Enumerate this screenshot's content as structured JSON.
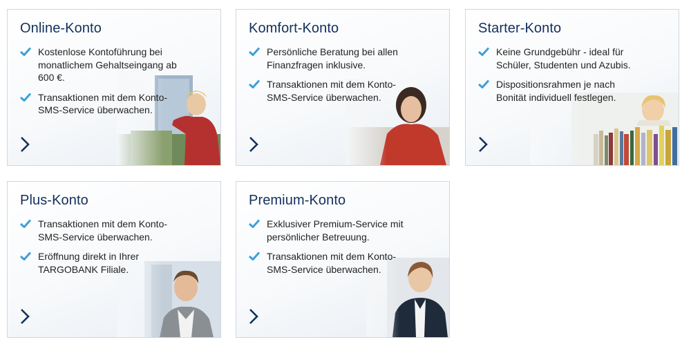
{
  "colors": {
    "title": "#12305c",
    "check": "#3b9fd8",
    "arrow": "#12305c",
    "border": "#d2d7dd"
  },
  "cards": [
    {
      "title": "Online-Konto",
      "features": [
        "Kostenlose Kontoführung bei monatlichem Gehaltseingang ab 600 €.",
        "Transaktionen mit dem Konto-SMS-Service überwachen."
      ]
    },
    {
      "title": "Komfort-Konto",
      "features": [
        "Persönliche Beratung bei allen Finanzfragen inklusive.",
        "Transaktionen mit dem Konto-SMS-Service überwachen."
      ]
    },
    {
      "title": "Starter-Konto",
      "features": [
        "Keine Grundgebühr - ideal für Schüler, Studenten und Azubis.",
        "Dispositionsrahmen je nach Bonität individuell festlegen."
      ]
    },
    {
      "title": "Plus-Konto",
      "features": [
        "Transaktionen mit dem Konto-SMS-Service überwachen.",
        "Eröffnung direkt in Ihrer TARGOBANK Filiale."
      ]
    },
    {
      "title": "Premium-Konto",
      "features": [
        "Exklusiver Premium-Service mit persönlicher Betreuung.",
        "Transaktionen mit dem Konto-SMS-Service überwachen."
      ]
    }
  ]
}
